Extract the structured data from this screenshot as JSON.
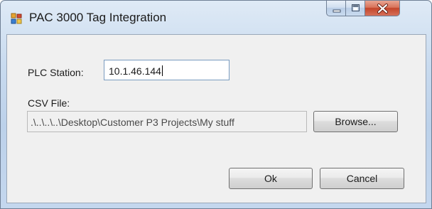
{
  "window": {
    "title": "PAC 3000 Tag Integration"
  },
  "form": {
    "plc_label": "PLC Station:",
    "plc_value": "10.1.46.144",
    "csv_label": "CSV File:",
    "csv_value": ".\\..\\..\\..\\Desktop\\Customer P3 Projects\\My stuff"
  },
  "buttons": {
    "browse": "Browse...",
    "ok": "Ok",
    "cancel": "Cancel"
  },
  "icons": {
    "app": "app-window-icon",
    "minimize": "minimize-icon",
    "maximize": "maximize-icon",
    "close": "close-icon"
  },
  "colors": {
    "frame": "#c9dbef",
    "close_button": "#c4452a",
    "client_background": "#f0f0f0"
  }
}
